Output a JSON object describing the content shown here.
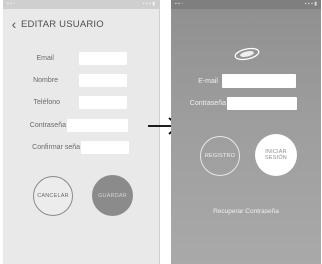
{
  "edit_screen": {
    "title": "EDITAR USUARIO",
    "fields": [
      {
        "label": "Email"
      },
      {
        "label": "Nombre"
      },
      {
        "label": "Teléfono"
      },
      {
        "label": "Contraseña"
      },
      {
        "label": "Confirmar seña"
      }
    ],
    "cancel_label": "CANCELAR",
    "save_label": "GUARDAR"
  },
  "login_screen": {
    "fields": [
      {
        "label": "E-mail"
      },
      {
        "label": "Contraseña"
      }
    ],
    "register_label": "REGISTRO",
    "login_label_line1": "INICIAR",
    "login_label_line2": "SESIÓN",
    "recover_label": "Recuperar Contraseña"
  },
  "colors": {
    "edit_background": "#e9e9e9",
    "login_background": "#9a9a9a",
    "save_button": "#8b8b8b"
  },
  "icons": [
    "back-arrow-icon",
    "transition-arrow-icon",
    "app-logo-icon"
  ]
}
